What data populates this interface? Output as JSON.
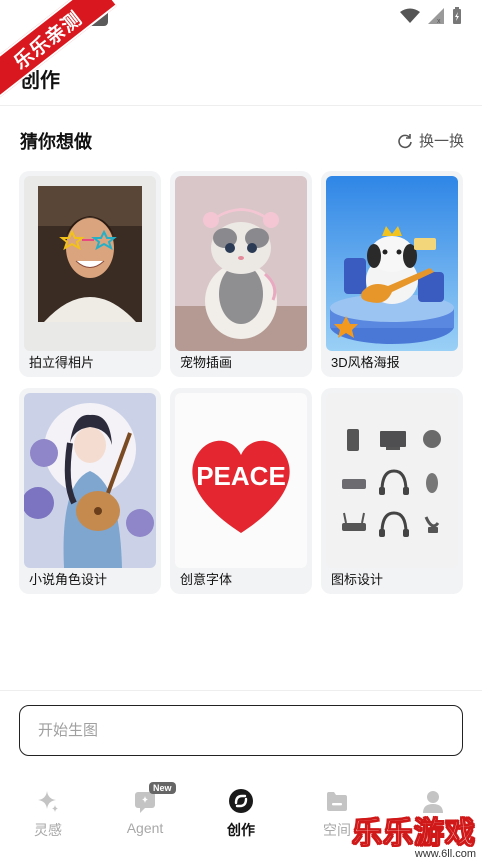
{
  "watermark": {
    "ribbon_text": "乐乐亲测",
    "game_text": "乐乐游戏",
    "url_text": "www.6ll.com"
  },
  "header": {
    "title": "创作"
  },
  "suggestions": {
    "title": "猜你想做",
    "refresh_label": "换一换",
    "cards": [
      {
        "label": "拍立得相片",
        "image": "portrait-polaroid-image"
      },
      {
        "label": "宠物插画",
        "image": "kitten-illustration-image"
      },
      {
        "label": "3D风格海报",
        "image": "3d-dog-guitar-image"
      },
      {
        "label": "小说角色设计",
        "image": "anime-girl-lute-image"
      },
      {
        "label": "创意字体",
        "image": "peace-heart-image"
      },
      {
        "label": "图标设计",
        "image": "device-icons-image"
      }
    ]
  },
  "composer": {
    "placeholder": "开始生图"
  },
  "nav": {
    "items": [
      {
        "label": "灵感",
        "icon": "sparkle-icon"
      },
      {
        "label": "Agent",
        "icon": "agent-chat-icon",
        "badge": "New"
      },
      {
        "label": "创作",
        "icon": "create-swirl-icon",
        "active": true
      },
      {
        "label": "空间",
        "icon": "folder-icon"
      },
      {
        "label": "",
        "icon": "profile-icon"
      }
    ]
  },
  "colors": {
    "accent": "#111111",
    "inactive": "#a8a8a8",
    "card_bg": "#f2f3f5",
    "watermark_red": "#d8181e"
  }
}
